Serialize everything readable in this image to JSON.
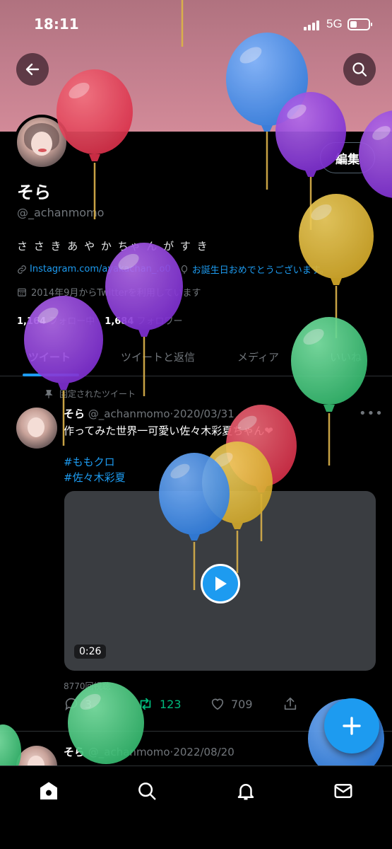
{
  "status": {
    "time": "18:11",
    "network": "5G"
  },
  "profile": {
    "name": "そら",
    "handle": "@_achanmomo",
    "bio": "さ さ き あ や か ちゃ ん が す き",
    "link": "Instagram.com/ayakachan_.o0",
    "announcement": "お誕生日おめでとうございます。",
    "joined": "2014年9月からTwitterを利用しています",
    "following_count": "1,164",
    "following_label": "フォロー中",
    "followers_count": "1,684",
    "followers_label": "フォロワー",
    "edit_label": "編集"
  },
  "tabs": [
    {
      "label": "ツイート"
    },
    {
      "label": "ツイートと返信"
    },
    {
      "label": "メディア"
    },
    {
      "label": "いいね"
    }
  ],
  "pinned_tweet": {
    "pinned_label": "固定されたツイート",
    "name": "そら",
    "handle": "@_achanmomo",
    "date": "2020/03/31",
    "text": "作ってみた世界一可愛い佐々木彩夏ちゃん❤",
    "hashtags": [
      "#ももクロ",
      "#佐々木彩夏"
    ],
    "video_duration": "0:26",
    "views": "8770回視聴",
    "reply_count": "3",
    "retweet_count": "123",
    "like_count": "709"
  },
  "second_tweet": {
    "name": "そら",
    "handle": "@_achanmomo",
    "date": "2022/08/20"
  },
  "colors": {
    "accent": "#1d9bf0",
    "retweet": "#00ba7c",
    "banner": "#c07d8c"
  }
}
